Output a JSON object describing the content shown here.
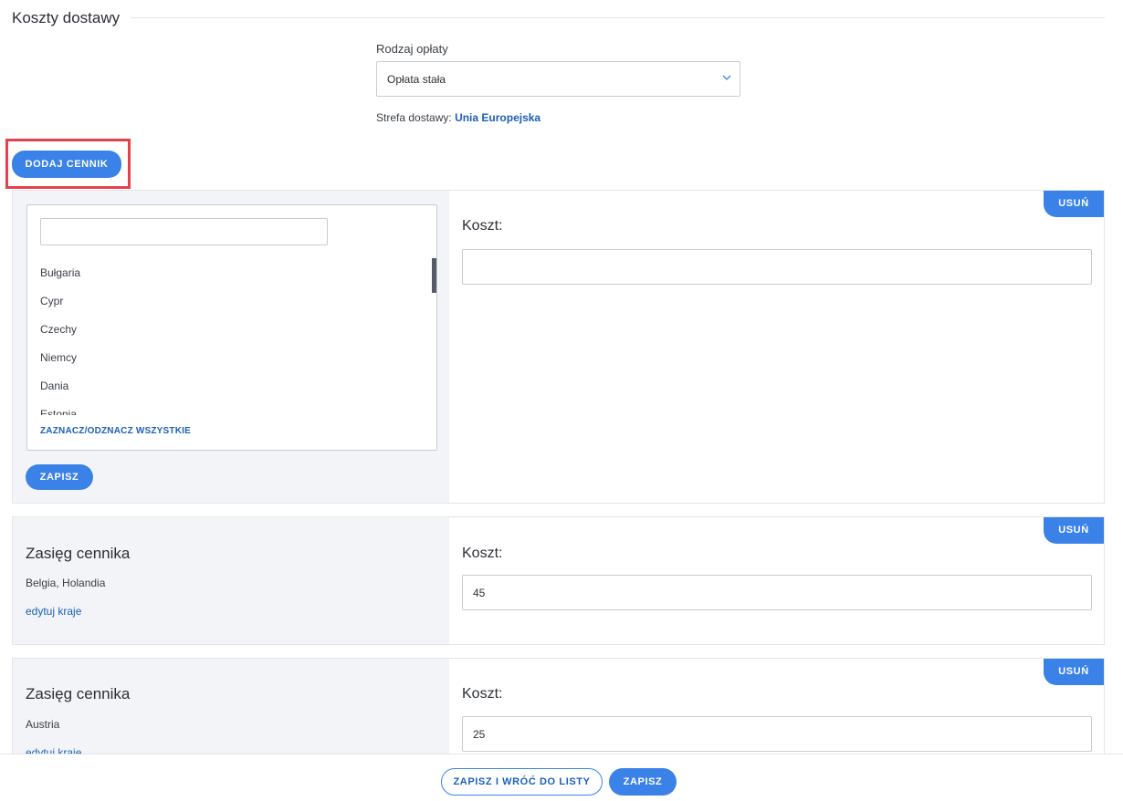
{
  "section": {
    "title": "Koszty dostawy"
  },
  "fee": {
    "label": "Rodzaj opłaty",
    "value": "Opłata stała"
  },
  "zone": {
    "label": "Strefa dostawy:",
    "value": "Unia Europejska"
  },
  "add_button": "DODAJ CENNIK",
  "remove_label": "USUŃ",
  "cost_label": "Koszt:",
  "editor": {
    "search_value": "",
    "countries": [
      "Bułgaria",
      "Cypr",
      "Czechy",
      "Niemcy",
      "Dania",
      "Estonia"
    ],
    "toggle_all": "ZAZNACZ/ODZNACZ WSZYSTKIE",
    "save": "ZAPISZ",
    "cost_value": ""
  },
  "ranges": [
    {
      "title": "Zasięg cennika",
      "countries": "Belgia, Holandia",
      "edit": "edytuj kraje",
      "cost": "45"
    },
    {
      "title": "Zasięg cennika",
      "countries": "Austria",
      "edit": "edytuj kraje",
      "cost": "25"
    }
  ],
  "footer": {
    "save_back": "ZAPISZ I WRÓĆ DO LISTY",
    "save": "ZAPISZ"
  },
  "colors": {
    "accent": "#3b82e8",
    "link": "#1d5fb8",
    "highlight": "#e8404b",
    "panel": "#f2f4f7"
  }
}
